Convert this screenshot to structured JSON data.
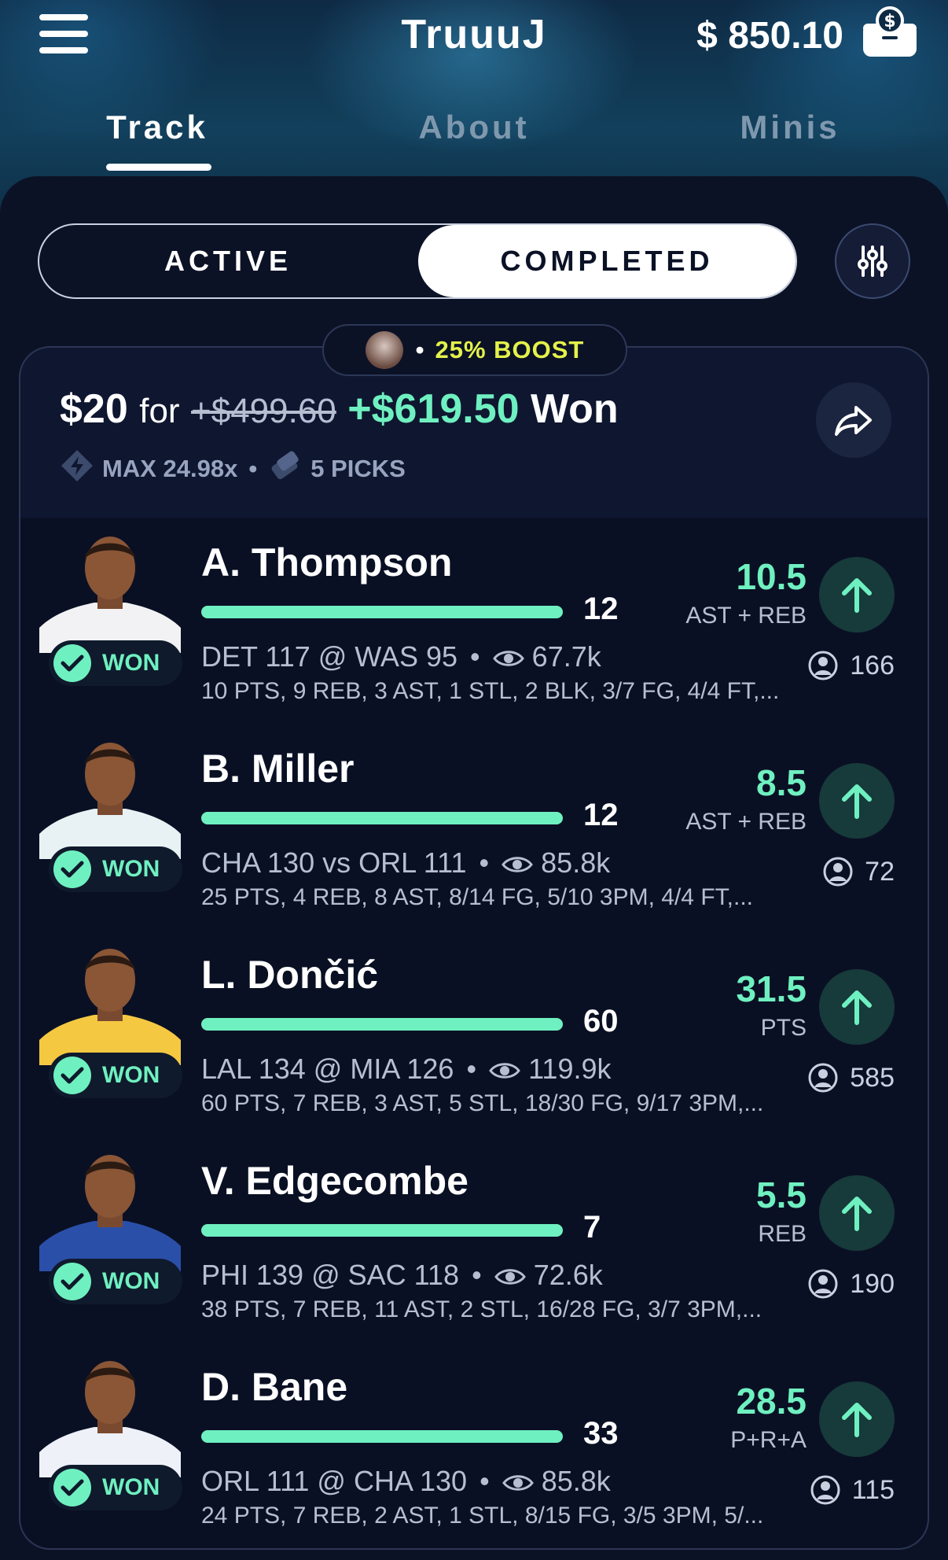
{
  "header": {
    "title": "TruuuJ",
    "balance": "$ 850.10"
  },
  "tabs": [
    {
      "label": "Track",
      "active": true
    },
    {
      "label": "About",
      "active": false
    },
    {
      "label": "Minis",
      "active": false
    }
  ],
  "segment": {
    "active_label": "ACTIVE",
    "completed_label": "COMPLETED",
    "selected": "COMPLETED"
  },
  "card": {
    "boost": {
      "dot": "•",
      "label": "25% BOOST"
    },
    "entry": "$20",
    "for_text": "for",
    "original_payout": "+$499.60",
    "won_amount": "+$619.50",
    "won_label": "Won",
    "max_multiplier": "MAX 24.98x",
    "separator": "•",
    "picks": "5 PICKS"
  },
  "colors": {
    "accent": "#6ff0c0",
    "boost": "#e4f24a",
    "background": "#0a0f1e"
  },
  "picks": [
    {
      "name": "A. Thompson",
      "stat": "12",
      "result": "WON",
      "game": "DET 117 @ WAS 95",
      "views": "67.7k",
      "line": "10 PTS, 9 REB, 3 AST, 1 STL, 2 BLK, 3/7 FG, 4/4 FT,...",
      "target": "10.5",
      "market": "AST + REB",
      "direction": "up",
      "pickers": "166",
      "jersey": "#f2f2f4"
    },
    {
      "name": "B. Miller",
      "stat": "12",
      "result": "WON",
      "game": "CHA 130 vs ORL 111",
      "views": "85.8k",
      "line": "25 PTS, 4 REB, 8 AST, 8/14 FG, 5/10 3PM, 4/4 FT,...",
      "target": "8.5",
      "market": "AST + REB",
      "direction": "up",
      "pickers": "72",
      "jersey": "#e8f2f4"
    },
    {
      "name": "L. Dončić",
      "stat": "60",
      "result": "WON",
      "game": "LAL 134 @ MIA 126",
      "views": "119.9k",
      "line": "60 PTS, 7 REB, 3 AST, 5 STL, 18/30 FG, 9/17 3PM,...",
      "target": "31.5",
      "market": "PTS",
      "direction": "up",
      "pickers": "585",
      "jersey": "#f5c842"
    },
    {
      "name": "V. Edgecombe",
      "stat": "7",
      "result": "WON",
      "game": "PHI 139 @ SAC 118",
      "views": "72.6k",
      "line": "38 PTS, 7 REB, 11 AST, 2 STL, 16/28 FG, 3/7 3PM,...",
      "target": "5.5",
      "market": "REB",
      "direction": "up",
      "pickers": "190",
      "jersey": "#2a4fa8"
    },
    {
      "name": "D. Bane",
      "stat": "33",
      "result": "WON",
      "game": "ORL 111 @ CHA 130",
      "views": "85.8k",
      "line": "24 PTS, 7 REB, 2 AST, 1 STL, 8/15 FG, 3/5 3PM, 5/...",
      "target": "28.5",
      "market": "P+R+A",
      "direction": "up",
      "pickers": "115",
      "jersey": "#eef1f8"
    }
  ]
}
